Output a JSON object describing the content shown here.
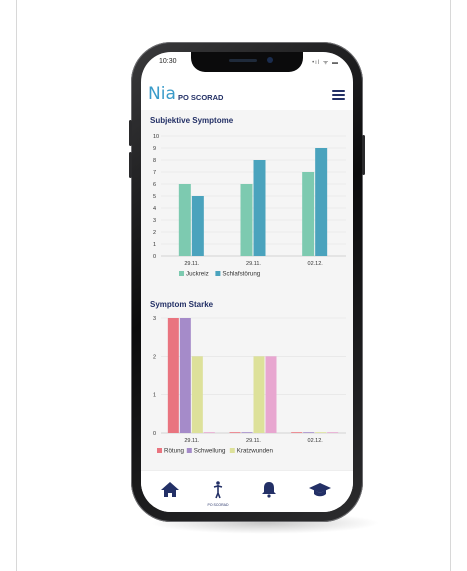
{
  "status_bar": {
    "time": "10:30",
    "indicators": "•ıl ᯤ ▬"
  },
  "app": {
    "logo_text": "Nia",
    "title": "PO SCORAD",
    "menu_icon": "hamburger-icon"
  },
  "colors": {
    "brand": "#3a9bc9",
    "navy": "#233066",
    "juckreiz": "#7dcab0",
    "schlafstoerung": "#4aa3bd",
    "roetung": "#e9747f",
    "schwellung": "#a58bc9",
    "kratzwunden": "#dde19a",
    "extra_series": "#e8a6d0"
  },
  "chart_data": [
    {
      "type": "bar",
      "title": "Subjektive Symptome",
      "categories": [
        "29.11.",
        "29.11.",
        "02.12."
      ],
      "series": [
        {
          "name": "Juckreiz",
          "values": [
            6,
            6,
            7
          ]
        },
        {
          "name": "Schlafstörung",
          "values": [
            5,
            8,
            9
          ]
        }
      ],
      "ylim": [
        0,
        10
      ],
      "yticks": [
        "0",
        "1",
        "2",
        "3",
        "4",
        "5",
        "6",
        "7",
        "8",
        "9",
        "10"
      ],
      "grid": true,
      "legend": "bottom"
    },
    {
      "type": "bar",
      "title": "Symptom Starke",
      "categories": [
        "29.11.",
        "29.11.",
        "02.12."
      ],
      "series": [
        {
          "name": "Rötung",
          "values": [
            3,
            0,
            0
          ]
        },
        {
          "name": "Schwellung",
          "values": [
            3,
            0,
            0
          ]
        },
        {
          "name": "Kratzwunden",
          "values": [
            2,
            2,
            0
          ]
        },
        {
          "values": [
            0,
            2,
            0
          ]
        }
      ],
      "ylim": [
        0,
        3
      ],
      "yticks": [
        "0",
        "1",
        "2",
        "3"
      ],
      "grid": true,
      "legend": "bottom"
    }
  ],
  "tabbar": {
    "items": [
      {
        "icon": "home-icon"
      },
      {
        "icon": "person-icon",
        "label": "PO SCORAD"
      },
      {
        "icon": "bell-icon"
      },
      {
        "icon": "graduation-cap-icon"
      }
    ]
  }
}
